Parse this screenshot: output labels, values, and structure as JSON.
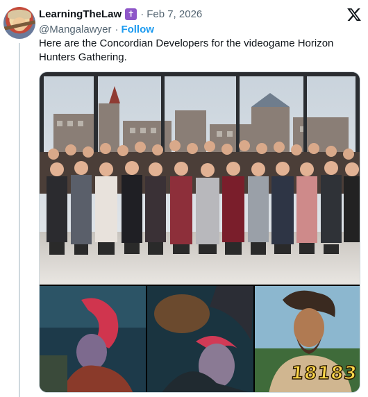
{
  "tweet": {
    "author": {
      "display_name": "LearningTheLaw",
      "badge_glyph": "✝",
      "handle": "@Mangalawyer"
    },
    "separator": "·",
    "date": "Feb 7, 2026",
    "follow_label": "Follow",
    "text_line1": "Here are the Concordian Developers for the videogame Horizon",
    "text_line2": "Hunters Gathering."
  },
  "media": {
    "watermark": "18183"
  },
  "icons": {
    "platform_logo": "x-logo-icon",
    "badge": "cross-badge-icon"
  },
  "colors": {
    "link": "#1d9bf0",
    "muted": "#536471",
    "badge": "#8e56c8"
  }
}
